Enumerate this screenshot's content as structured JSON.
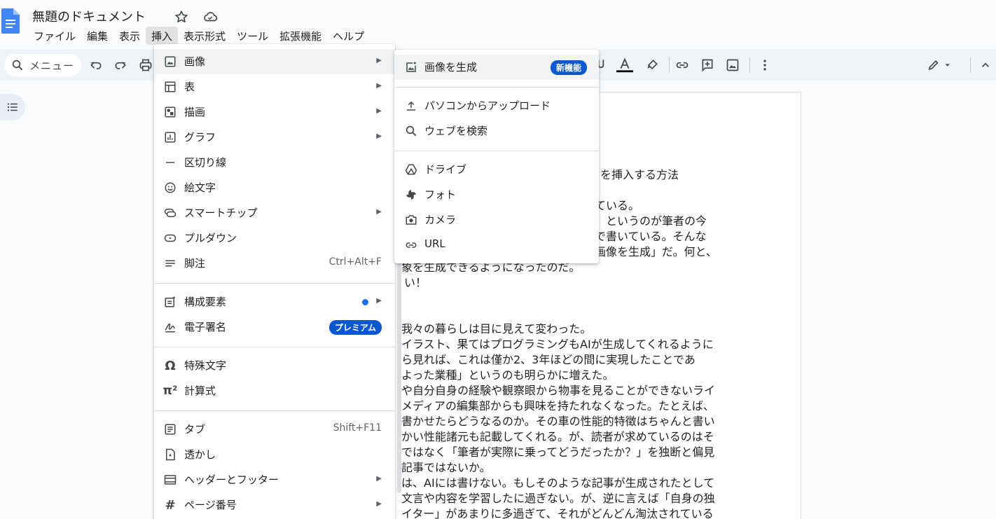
{
  "app": {
    "doc_title": "無題のドキュメント",
    "menubar": [
      "ファイル",
      "編集",
      "表示",
      "挿入",
      "表示形式",
      "ツール",
      "拡張機能",
      "ヘルプ"
    ]
  },
  "toolbar": {
    "search_label": "メニュー"
  },
  "insert_menu": {
    "items": [
      {
        "label": "画像",
        "icon": "image-icon",
        "arrow": true,
        "highlighted": true
      },
      {
        "label": "表",
        "icon": "table-icon",
        "arrow": true
      },
      {
        "label": "描画",
        "icon": "drawing-icon",
        "arrow": true
      },
      {
        "label": "グラフ",
        "icon": "chart-icon",
        "arrow": true
      },
      {
        "label": "区切り線",
        "icon": "horizontal-line-icon"
      },
      {
        "label": "絵文字",
        "icon": "emoji-icon"
      },
      {
        "label": "スマートチップ",
        "icon": "smart-chip-icon",
        "arrow": true
      },
      {
        "label": "プルダウン",
        "icon": "dropdown-icon"
      },
      {
        "label": "脚注",
        "icon": "footnote-icon",
        "shortcut": "Ctrl+Alt+F"
      },
      {
        "label": "構成要素",
        "icon": "building-blocks-icon",
        "arrow": true,
        "dot": true
      },
      {
        "label": "電子署名",
        "icon": "signature-icon",
        "badge": "プレミアム"
      },
      {
        "label": "特殊文字",
        "icon": "omega-icon"
      },
      {
        "label": "計算式",
        "icon": "equation-icon"
      },
      {
        "label": "タブ",
        "icon": "tab-icon",
        "shortcut": "Shift+F11"
      },
      {
        "label": "透かし",
        "icon": "watermark-icon"
      },
      {
        "label": "ヘッダーとフッター",
        "icon": "header-footer-icon",
        "arrow": true
      },
      {
        "label": "ページ番号",
        "icon": "hash-icon",
        "arrow": true
      }
    ]
  },
  "image_submenu": {
    "items": [
      {
        "label": "画像を生成",
        "icon": "generate-image-icon",
        "badge": "新機能",
        "highlighted": true
      },
      {
        "label": "パソコンからアップロード",
        "icon": "upload-icon"
      },
      {
        "label": "ウェブを検索",
        "icon": "search-icon"
      },
      {
        "label": "ドライブ",
        "icon": "drive-icon"
      },
      {
        "label": "フォト",
        "icon": "photos-icon"
      },
      {
        "label": "カメラ",
        "icon": "camera-icon"
      },
      {
        "label": "URL",
        "icon": "link-icon"
      }
    ]
  },
  "document": {
    "visible_lines": [
      "を挿入する方法",
      "ている。",
      "、というのが筆者の今",
      "で書いている。そんな",
      "画像を生成」だ。何と、",
      "象を生成できるようになったのだ。",
      "い！",
      "我々の暮らしは目に見えて変わった。",
      "イラスト、果てはプログラミングもAIが生成してくれるように",
      "ら見れば、これは僅か2、3年ほどの間に実現したことであ",
      "よった業種」というのも明らかに増えた。",
      "や自分自身の経験や観察眼から物事を見ることができないライ",
      "メディアの編集部からも興味を持たれなくなった。たとえば、",
      "書かせたらどうなるのか。その車の性能的特徴はちゃんと書い",
      "かい性能諸元も記載してくれる。が、読者が求めているのはそ",
      "ではなく「筆者が実際に乗ってどうだったか？」を独断と偏見",
      "記事ではないか。",
      "は、AIには書けない。もしそのような記事が生成されたとして",
      "文言や内容を学習したに過ぎない。が、逆に言えば「自身の独",
      "イター」があまりに多過ぎて、それがどんどん淘汰されている"
    ]
  },
  "colors": {
    "accent": "#0b57d0",
    "doc_blue": "#4285f4",
    "menu_highlight": "#f1f3f4"
  }
}
